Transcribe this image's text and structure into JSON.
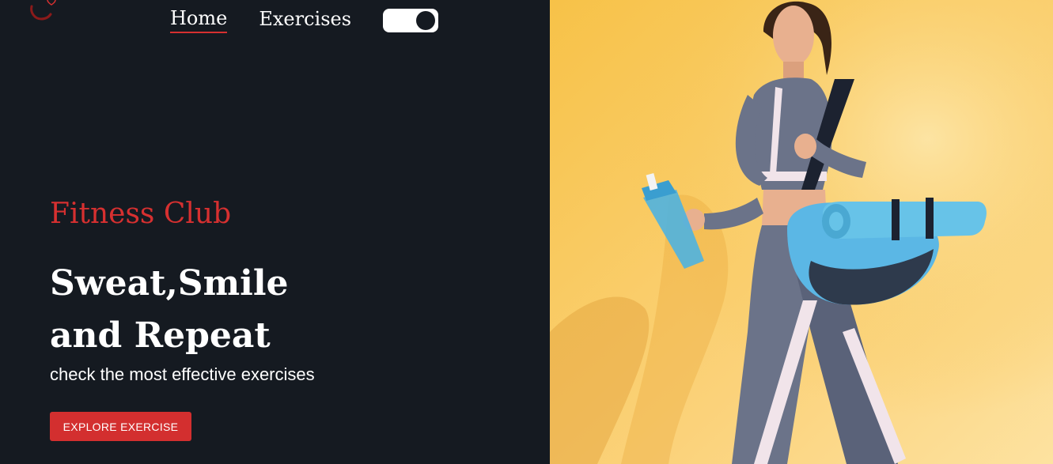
{
  "nav": {
    "links": [
      {
        "label": "Home",
        "active": true
      },
      {
        "label": "Exercises",
        "active": false
      }
    ],
    "theme_toggle": {
      "state": "on"
    }
  },
  "hero": {
    "brand": "Fitness Club",
    "headline_line1": "Sweat,Smile",
    "headline_line2": "and Repeat",
    "subtitle": "check the most effective exercises",
    "cta_label": "EXPLORE EXERCISE"
  },
  "colors": {
    "background": "#151a21",
    "accent": "#d63030",
    "text": "#ffffff",
    "hero_bg": "#f9c74f"
  },
  "icons": {
    "logo": "heart-gym-logo-icon"
  }
}
